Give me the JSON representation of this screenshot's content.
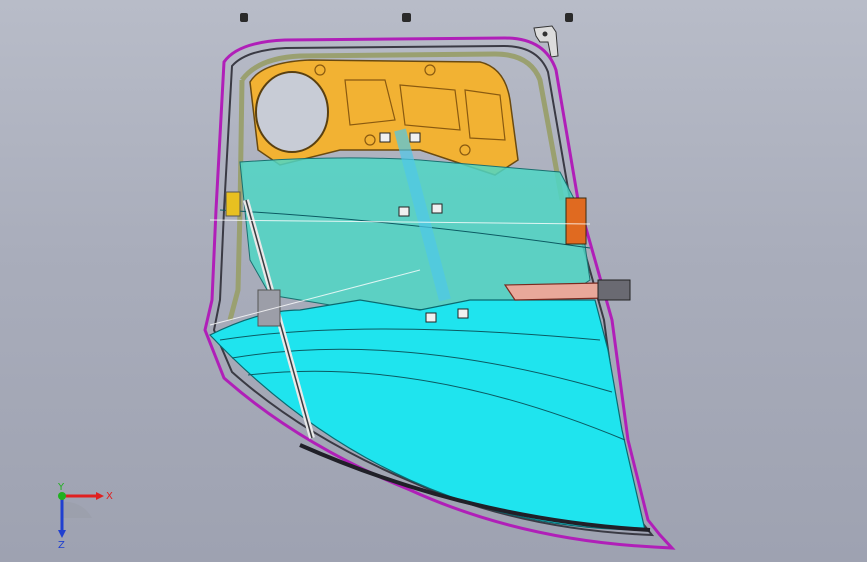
{
  "viewport": {
    "model": "car-door-assembly",
    "colors": {
      "background_top": "#b8bcc8",
      "background_bottom": "#9ea2b1",
      "glass": "#1fe4ee",
      "glass_upper": "#4fd6c4",
      "inner_panel": "#f2b233",
      "door_outline": "#b01fb8",
      "seal": "#9aa070",
      "handle": "#e9a89a"
    }
  },
  "triad": {
    "x_label": "X",
    "y_label": "Y",
    "z_label": "Z",
    "x_color": "#e02020",
    "y_color": "#20b020",
    "z_color": "#2040d0"
  }
}
